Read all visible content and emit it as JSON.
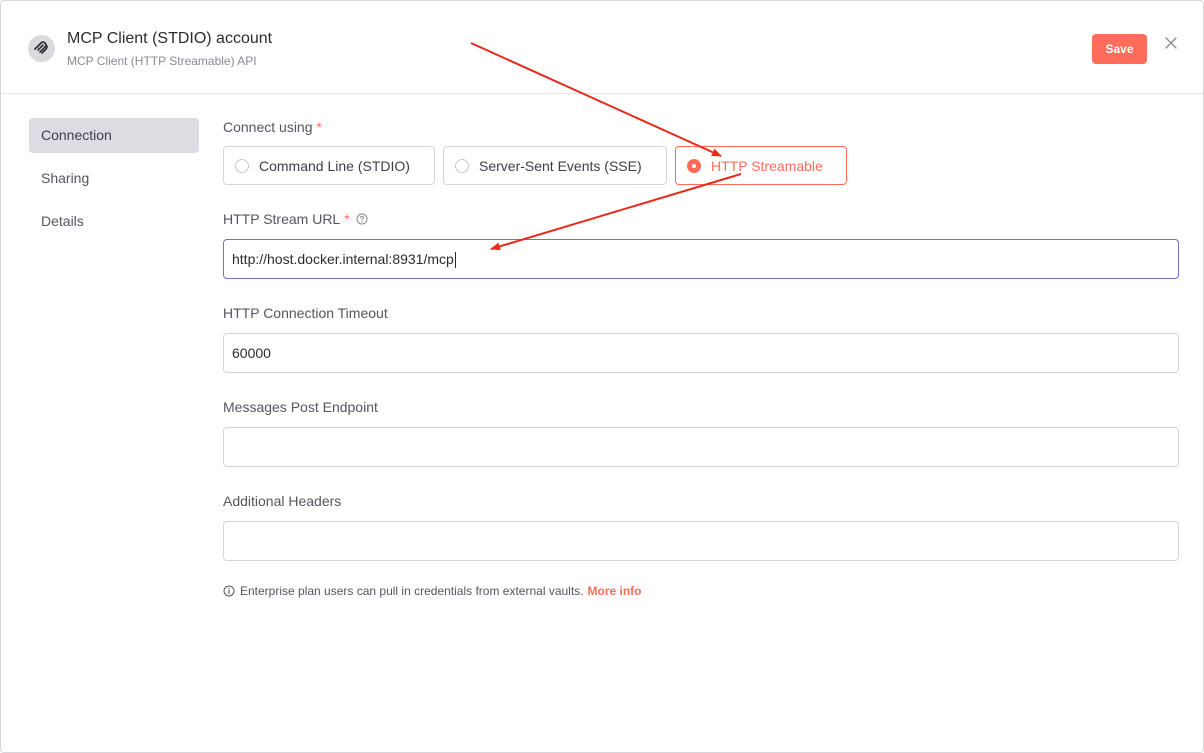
{
  "header": {
    "title": "MCP Client (STDIO) account",
    "subtitle": "MCP Client (HTTP Streamable) API",
    "save_label": "Save",
    "close_icon": "close-icon",
    "logo_icon": "mcp-logo-icon"
  },
  "sidebar": {
    "items": [
      {
        "label": "Connection",
        "active": true
      },
      {
        "label": "Sharing",
        "active": false
      },
      {
        "label": "Details",
        "active": false
      }
    ]
  },
  "form": {
    "connect_using": {
      "label": "Connect using",
      "required_mark": "*",
      "options": [
        {
          "label": "Command Line (STDIO)",
          "selected": false
        },
        {
          "label": "Server-Sent Events (SSE)",
          "selected": false
        },
        {
          "label": "HTTP Streamable",
          "selected": true
        }
      ]
    },
    "stream_url": {
      "label": "HTTP Stream URL",
      "required_mark": "*",
      "help_icon": "help-icon",
      "value": "http://host.docker.internal:8931/mcp"
    },
    "timeout": {
      "label": "HTTP Connection Timeout",
      "value": "60000"
    },
    "post_endpoint": {
      "label": "Messages Post Endpoint",
      "value": ""
    },
    "headers": {
      "label": "Additional Headers",
      "value": ""
    },
    "note": {
      "text": "Enterprise plan users can pull in credentials from external vaults.",
      "link": "More info",
      "icon": "info-icon"
    }
  },
  "colors": {
    "accent": "#ff6d5a",
    "focus": "#7a6bd6",
    "annotation": "#e8291c"
  }
}
